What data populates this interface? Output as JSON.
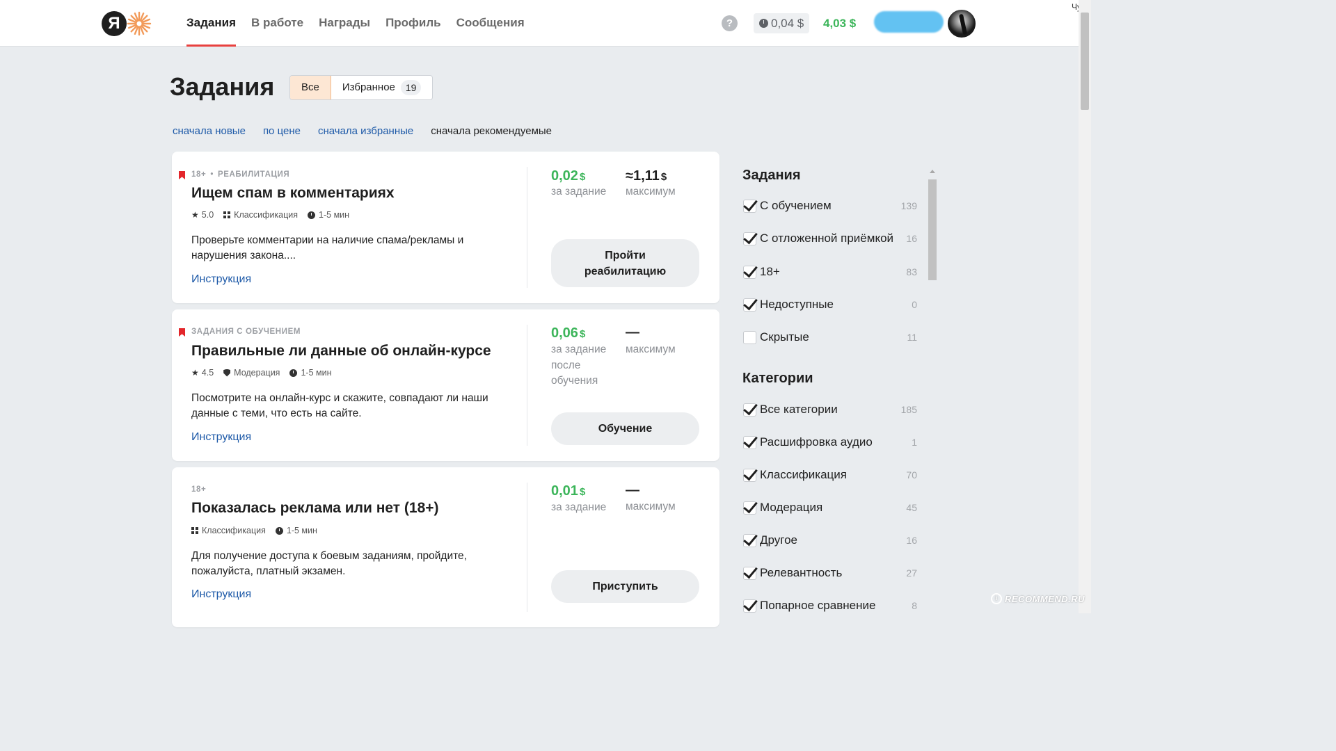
{
  "header": {
    "logo_letter": "Я",
    "nav": [
      "Задания",
      "В работе",
      "Награды",
      "Профиль",
      "Сообщения"
    ],
    "help": "?",
    "pending_balance": "0,04 $",
    "balance": "4,03 $",
    "corner_text": "Чуи"
  },
  "page": {
    "title": "Задания",
    "segments": {
      "all": "Все",
      "favorites": "Избранное",
      "favorites_count": "19"
    },
    "sorts": [
      "сначала новые",
      "по цене",
      "сначала избранные",
      "сначала рекомендуемые"
    ]
  },
  "tasks": [
    {
      "tag1": "18+",
      "tag2": "РЕАБИЛИТАЦИЯ",
      "title": "Ищем спам в комментариях",
      "rating": "5.0",
      "category": "Классификация",
      "time": "1-5 мин",
      "desc": "Проверьте комментарии на наличие спама/рекламы и нарушения закона....",
      "instr": "Инструкция",
      "price": "0,02",
      "currency": "$",
      "price_label": "за задание",
      "max_prefix": "≈",
      "max": "1,11",
      "max_label": "максимум",
      "action": "Пройти реабилитацию"
    },
    {
      "tag1": "ЗАДАНИЯ С ОБУЧЕНИЕМ",
      "title": "Правильные ли данные об онлайн-курсе",
      "rating": "4.5",
      "category": "Модерация",
      "time": "1-5 мин",
      "desc": "Посмотрите на онлайн-курс и скажите, совпадают ли наши данные с теми, что есть на сайте.",
      "instr": "Инструкция",
      "price": "0,06",
      "currency": "$",
      "price_label": "за задание после обучения",
      "max": "—",
      "max_label": "максимум",
      "action": "Обучение"
    },
    {
      "tag1": "18+",
      "title": "Показалась реклама или нет (18+)",
      "category": "Классификация",
      "time": "1-5 мин",
      "desc": "Для получение доступа к боевым заданиям, пройдите, пожалуйста, платный экзамен.",
      "instr": "Инструкция",
      "price": "0,01",
      "currency": "$",
      "price_label": "за задание",
      "max": "—",
      "max_label": "максимум",
      "action": "Приступить"
    }
  ],
  "sidebar": {
    "tasks_title": "Задания",
    "task_filters": [
      {
        "label": "С обучением",
        "count": "139",
        "checked": true
      },
      {
        "label": "С отложенной приёмкой",
        "count": "16",
        "checked": true
      },
      {
        "label": "18+",
        "count": "83",
        "checked": true
      },
      {
        "label": "Недоступные",
        "count": "0",
        "checked": true
      },
      {
        "label": "Скрытые",
        "count": "11",
        "checked": false
      }
    ],
    "categories_title": "Категории",
    "categories": [
      {
        "label": "Все категории",
        "count": "185",
        "checked": true
      },
      {
        "label": "Расшифровка аудио",
        "count": "1",
        "checked": true
      },
      {
        "label": "Классификация",
        "count": "70",
        "checked": true
      },
      {
        "label": "Модерация",
        "count": "45",
        "checked": true
      },
      {
        "label": "Другое",
        "count": "16",
        "checked": true
      },
      {
        "label": "Релевантность",
        "count": "27",
        "checked": true
      },
      {
        "label": "Попарное сравнение",
        "count": "8",
        "checked": true
      }
    ]
  },
  "watermark": {
    "badge": "i",
    "text": "RECOMMEND.RU"
  },
  "colors": {
    "accent_red": "#e8413e",
    "money_green": "#3cb55a",
    "link_blue": "#1e5aa8",
    "active_segment": "#fde7d4"
  }
}
